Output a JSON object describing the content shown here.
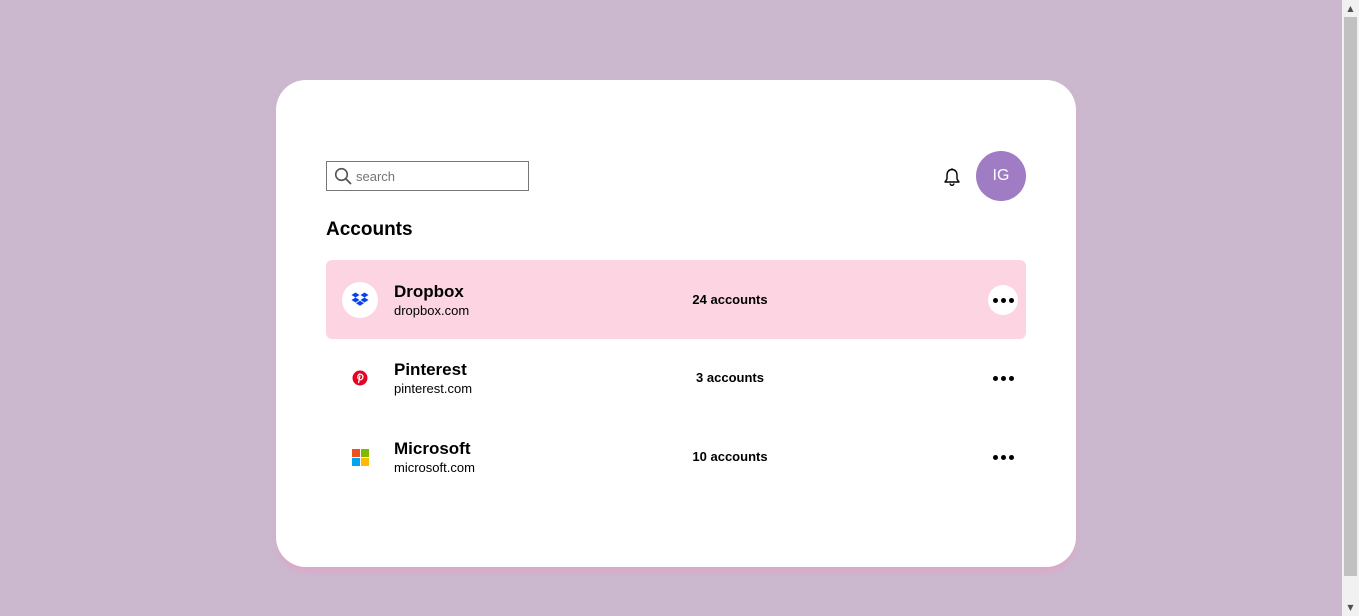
{
  "search": {
    "placeholder": "search",
    "value": ""
  },
  "header": {
    "avatar_initials": "IG",
    "avatar_color": "#a07cc4",
    "notification_icon": "bell-icon"
  },
  "page_title": "Accounts",
  "accounts": [
    {
      "name": "Dropbox",
      "domain": "dropbox.com",
      "count": "24 accounts",
      "icon": "dropbox-icon",
      "selected": true
    },
    {
      "name": "Pinterest",
      "domain": "pinterest.com",
      "count": "3 accounts",
      "icon": "pinterest-icon",
      "selected": false
    },
    {
      "name": "Microsoft",
      "domain": "microsoft.com",
      "count": "10 accounts",
      "icon": "microsoft-icon",
      "selected": false
    }
  ],
  "colors": {
    "background": "#cbb8cf",
    "card": "#ffffff",
    "selected_row": "#fcd4e2",
    "accent": "#a07cc4"
  }
}
